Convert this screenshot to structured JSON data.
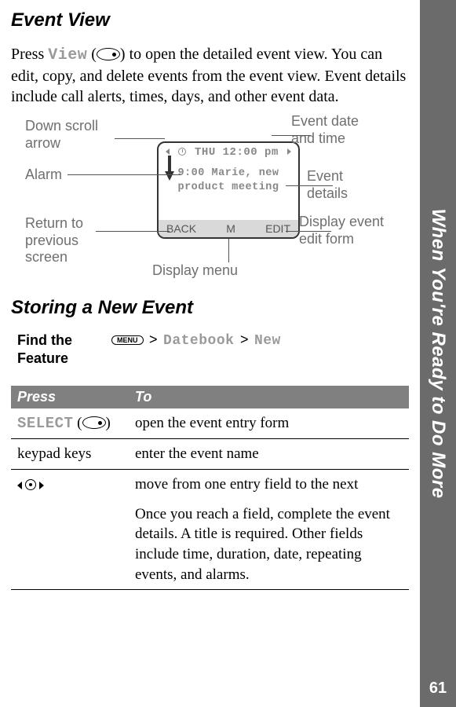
{
  "page_number": "61",
  "side_tab": "When You're Ready to Do More",
  "section1": {
    "heading": "Event View",
    "para_parts": {
      "p1a": "Press ",
      "view_label": "View",
      "p1b": " (",
      "p1c": ") to open the detailed event view. You can edit, copy, and delete events from the event view. Event details include call alerts, times, days, and other event data."
    }
  },
  "diagram": {
    "screen": {
      "datetime": "THU 12:00 pm",
      "detail_line1": "9:00 Marie, new",
      "detail_line2": "product meeting",
      "softkey_left": "BACK",
      "softkey_mid": "M",
      "softkey_right": "EDIT"
    },
    "callouts": {
      "down_scroll": "Down scroll arrow",
      "alarm": "Alarm",
      "return": "Return to previous screen",
      "event_datetime": "Event date and time",
      "event_details": "Event details",
      "display_edit": "Display event edit form",
      "display_menu": "Display menu"
    }
  },
  "section2": {
    "heading": "Storing a New Event",
    "find_label": "Find the Feature",
    "menu_label": "MENU",
    "crumb1": "Datebook",
    "crumb2": "New",
    "gt": ">"
  },
  "table": {
    "head_press": "Press",
    "head_to": "To",
    "rows": [
      {
        "press_mono": "SELECT",
        "press_plain": "",
        "has_softkey": true,
        "to": "open the event entry form"
      },
      {
        "press_mono": "",
        "press_plain": "keypad keys",
        "has_softkey": false,
        "to": "enter the event name"
      },
      {
        "press_mono": "",
        "press_plain": "",
        "has_nav": true,
        "to": "move from one entry field to the next",
        "to_extra": "Once you reach a field, complete the event details. A title is required. Other fields include time, duration, date, repeating events, and alarms."
      }
    ]
  }
}
